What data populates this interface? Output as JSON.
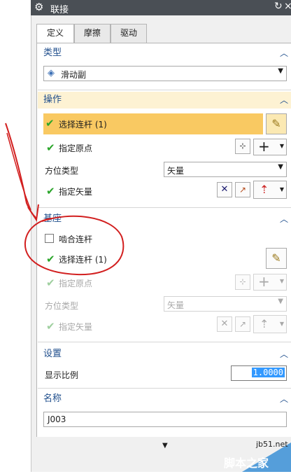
{
  "dialog": {
    "title": "联接"
  },
  "tabs": [
    {
      "label": "定义"
    },
    {
      "label": "摩擦"
    },
    {
      "label": "驱动"
    }
  ],
  "type_section": {
    "title": "类型",
    "value": "滑动副"
  },
  "operation_section": {
    "title": "操作",
    "select_link": "选择连杆 (1)",
    "specify_origin": "指定原点",
    "orientation_type_label": "方位类型",
    "orientation_type_value": "矢量",
    "specify_vector": "指定矢量"
  },
  "base_section": {
    "title": "基座",
    "mesh_link": "啮合连杆",
    "select_link": "选择连杆 (1)",
    "specify_origin": "指定原点",
    "orientation_type_label": "方位类型",
    "orientation_type_value": "矢量",
    "specify_vector": "指定矢量"
  },
  "settings_section": {
    "title": "设置",
    "scale_label": "显示比例",
    "scale_value": "1.0000"
  },
  "name_section": {
    "title": "名称",
    "value": "J003"
  },
  "watermark": {
    "site": "jb51.net",
    "text": "脚本之家"
  }
}
